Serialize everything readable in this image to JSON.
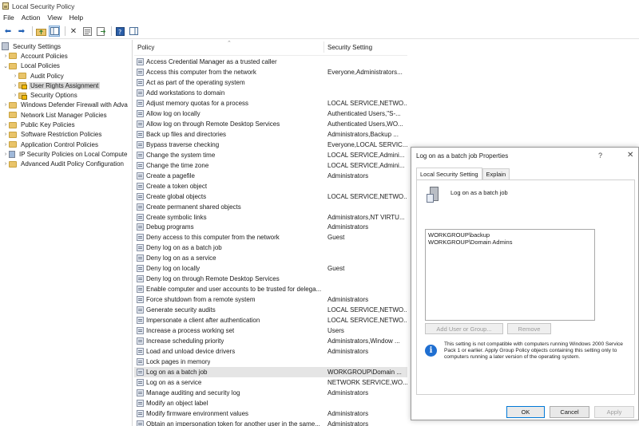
{
  "window": {
    "title": "Local Security Policy"
  },
  "menu": [
    "File",
    "Action",
    "View",
    "Help"
  ],
  "tree": [
    {
      "label": "Security Settings",
      "level": 0,
      "chevron": "",
      "icon": "shield"
    },
    {
      "label": "Account Policies",
      "level": 1,
      "chevron": ">",
      "icon": "folder"
    },
    {
      "label": "Local Policies",
      "level": 1,
      "chevron": "v",
      "icon": "folder"
    },
    {
      "label": "Audit Policy",
      "level": 2,
      "chevron": ">",
      "icon": "folder"
    },
    {
      "label": "User Rights Assignment",
      "level": 2,
      "chevron": ">",
      "icon": "folder-lock",
      "selected": true
    },
    {
      "label": "Security Options",
      "level": 2,
      "chevron": ">",
      "icon": "folder"
    },
    {
      "label": "Windows Defender Firewall with Adva",
      "level": 1,
      "chevron": ">",
      "icon": "folder"
    },
    {
      "label": "Network List Manager Policies",
      "level": 1,
      "chevron": "",
      "icon": "folder"
    },
    {
      "label": "Public Key Policies",
      "level": 1,
      "chevron": ">",
      "icon": "folder"
    },
    {
      "label": "Software Restriction Policies",
      "level": 1,
      "chevron": ">",
      "icon": "folder"
    },
    {
      "label": "Application Control Policies",
      "level": 1,
      "chevron": ">",
      "icon": "folder"
    },
    {
      "label": "IP Security Policies on Local Compute",
      "level": 1,
      "chevron": ">",
      "icon": "shield"
    },
    {
      "label": "Advanced Audit Policy Configuration",
      "level": 1,
      "chevron": ">",
      "icon": "folder"
    }
  ],
  "list": {
    "columns": [
      "Policy",
      "Security Setting"
    ],
    "rows": [
      {
        "policy": "Access Credential Manager as a trusted caller",
        "setting": ""
      },
      {
        "policy": "Access this computer from the network",
        "setting": "Everyone,Administrators..."
      },
      {
        "policy": "Act as part of the operating system",
        "setting": ""
      },
      {
        "policy": "Add workstations to domain",
        "setting": ""
      },
      {
        "policy": "Adjust memory quotas for a process",
        "setting": "LOCAL SERVICE,NETWO..."
      },
      {
        "policy": "Allow log on locally",
        "setting": "Authenticated Users,\"S-..."
      },
      {
        "policy": "Allow log on through Remote Desktop Services",
        "setting": "Authenticated Users,WO..."
      },
      {
        "policy": "Back up files and directories",
        "setting": "Administrators,Backup ..."
      },
      {
        "policy": "Bypass traverse checking",
        "setting": "Everyone,LOCAL SERVIC..."
      },
      {
        "policy": "Change the system time",
        "setting": "LOCAL SERVICE,Admini..."
      },
      {
        "policy": "Change the time zone",
        "setting": "LOCAL SERVICE,Admini..."
      },
      {
        "policy": "Create a pagefile",
        "setting": "Administrators"
      },
      {
        "policy": "Create a token object",
        "setting": ""
      },
      {
        "policy": "Create global objects",
        "setting": "LOCAL SERVICE,NETWO..."
      },
      {
        "policy": "Create permanent shared objects",
        "setting": ""
      },
      {
        "policy": "Create symbolic links",
        "setting": "Administrators,NT VIRTU..."
      },
      {
        "policy": "Debug programs",
        "setting": "Administrators"
      },
      {
        "policy": "Deny access to this computer from the network",
        "setting": "Guest"
      },
      {
        "policy": "Deny log on as a batch job",
        "setting": ""
      },
      {
        "policy": "Deny log on as a service",
        "setting": ""
      },
      {
        "policy": "Deny log on locally",
        "setting": "Guest"
      },
      {
        "policy": "Deny log on through Remote Desktop Services",
        "setting": ""
      },
      {
        "policy": "Enable computer and user accounts to be trusted for delega...",
        "setting": ""
      },
      {
        "policy": "Force shutdown from a remote system",
        "setting": "Administrators"
      },
      {
        "policy": "Generate security audits",
        "setting": "LOCAL SERVICE,NETWO..."
      },
      {
        "policy": "Impersonate a client after authentication",
        "setting": "LOCAL SERVICE,NETWO..."
      },
      {
        "policy": "Increase a process working set",
        "setting": "Users"
      },
      {
        "policy": "Increase scheduling priority",
        "setting": "Administrators,Window ..."
      },
      {
        "policy": "Load and unload device drivers",
        "setting": "Administrators"
      },
      {
        "policy": "Lock pages in memory",
        "setting": ""
      },
      {
        "policy": "Log on as a batch job",
        "setting": "WORKGROUP\\Domain ...",
        "selected": true
      },
      {
        "policy": "Log on as a service",
        "setting": "NETWORK SERVICE,WO..."
      },
      {
        "policy": "Manage auditing and security log",
        "setting": "Administrators"
      },
      {
        "policy": "Modify an object label",
        "setting": ""
      },
      {
        "policy": "Modify firmware environment values",
        "setting": "Administrators"
      },
      {
        "policy": "Obtain an impersonation token for another user in the same...",
        "setting": "Administrators"
      }
    ]
  },
  "dialog": {
    "title": "Log on as a batch job Properties",
    "help": "?",
    "close": "✕",
    "tabs": [
      "Local Security Setting",
      "Explain"
    ],
    "policy_name": "Log on as a batch job",
    "members": [
      "WORKGROUP\\backup",
      "WORKGROUP\\Domain Admins"
    ],
    "add_label": "Add User or Group...",
    "remove_label": "Remove",
    "info_glyph": "i",
    "info_text": "This setting is not compatible with computers running Windows 2000 Service Pack 1 or earlier.  Apply Group Policy objects containing this setting only to computers running a later version of the operating system.",
    "ok": "OK",
    "cancel": "Cancel",
    "apply": "Apply"
  }
}
